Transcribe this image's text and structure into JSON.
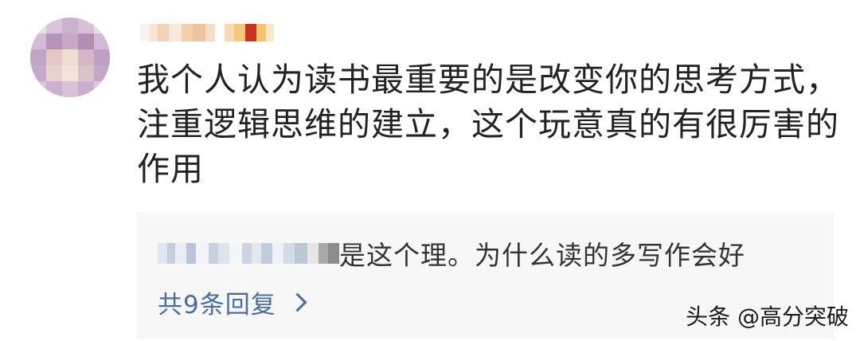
{
  "comment": {
    "lines": [
      "我个人认为读书最重要的是改变你的思考方式，",
      "注重逻辑思维的建立，这个玩意真的有很厉害的",
      "作用"
    ]
  },
  "reply": {
    "preview_text": "是这个理。为什么读的多写作会好",
    "count_label": "共9条回复"
  },
  "watermark": "头条 @高分突破",
  "colors": {
    "link": "#4a6ea0",
    "reply_bg": "#f7f7f7",
    "text": "#222222"
  }
}
